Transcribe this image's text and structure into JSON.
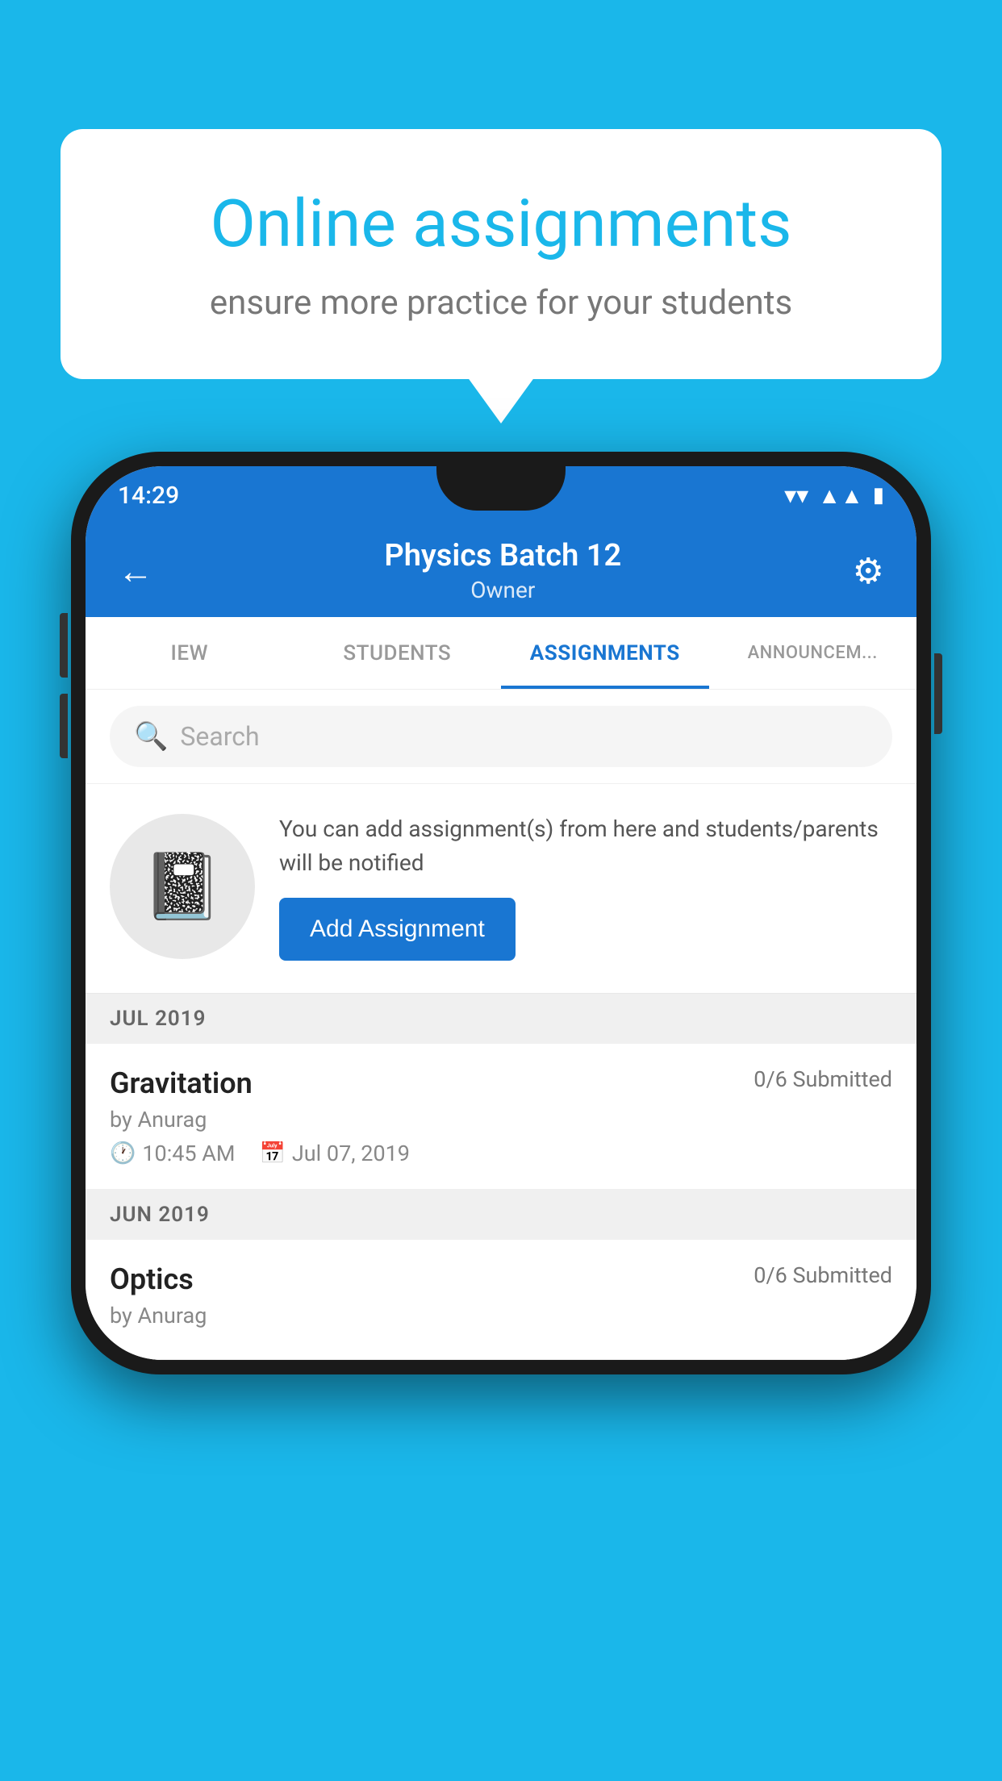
{
  "background": {
    "color": "#1ab7ea"
  },
  "speech_bubble": {
    "title": "Online assignments",
    "subtitle": "ensure more practice for your students"
  },
  "phone": {
    "status_bar": {
      "time": "14:29",
      "wifi_icon": "wifi",
      "signal_icon": "signal",
      "battery_icon": "battery"
    },
    "header": {
      "title": "Physics Batch 12",
      "subtitle": "Owner",
      "back_label": "←",
      "settings_label": "⚙"
    },
    "tabs": [
      {
        "label": "IEW",
        "active": false
      },
      {
        "label": "STUDENTS",
        "active": false
      },
      {
        "label": "ASSIGNMENTS",
        "active": true
      },
      {
        "label": "ANNOUNCEM...",
        "active": false
      }
    ],
    "search": {
      "placeholder": "Search"
    },
    "promo": {
      "description": "You can add assignment(s) from here and students/parents will be notified",
      "button_label": "Add Assignment"
    },
    "sections": [
      {
        "label": "JUL 2019",
        "assignments": [
          {
            "name": "Gravitation",
            "submitted": "0/6 Submitted",
            "by": "by Anurag",
            "time": "10:45 AM",
            "date": "Jul 07, 2019"
          }
        ]
      },
      {
        "label": "JUN 2019",
        "assignments": [
          {
            "name": "Optics",
            "submitted": "0/6 Submitted",
            "by": "by Anurag",
            "time": "",
            "date": ""
          }
        ]
      }
    ]
  }
}
